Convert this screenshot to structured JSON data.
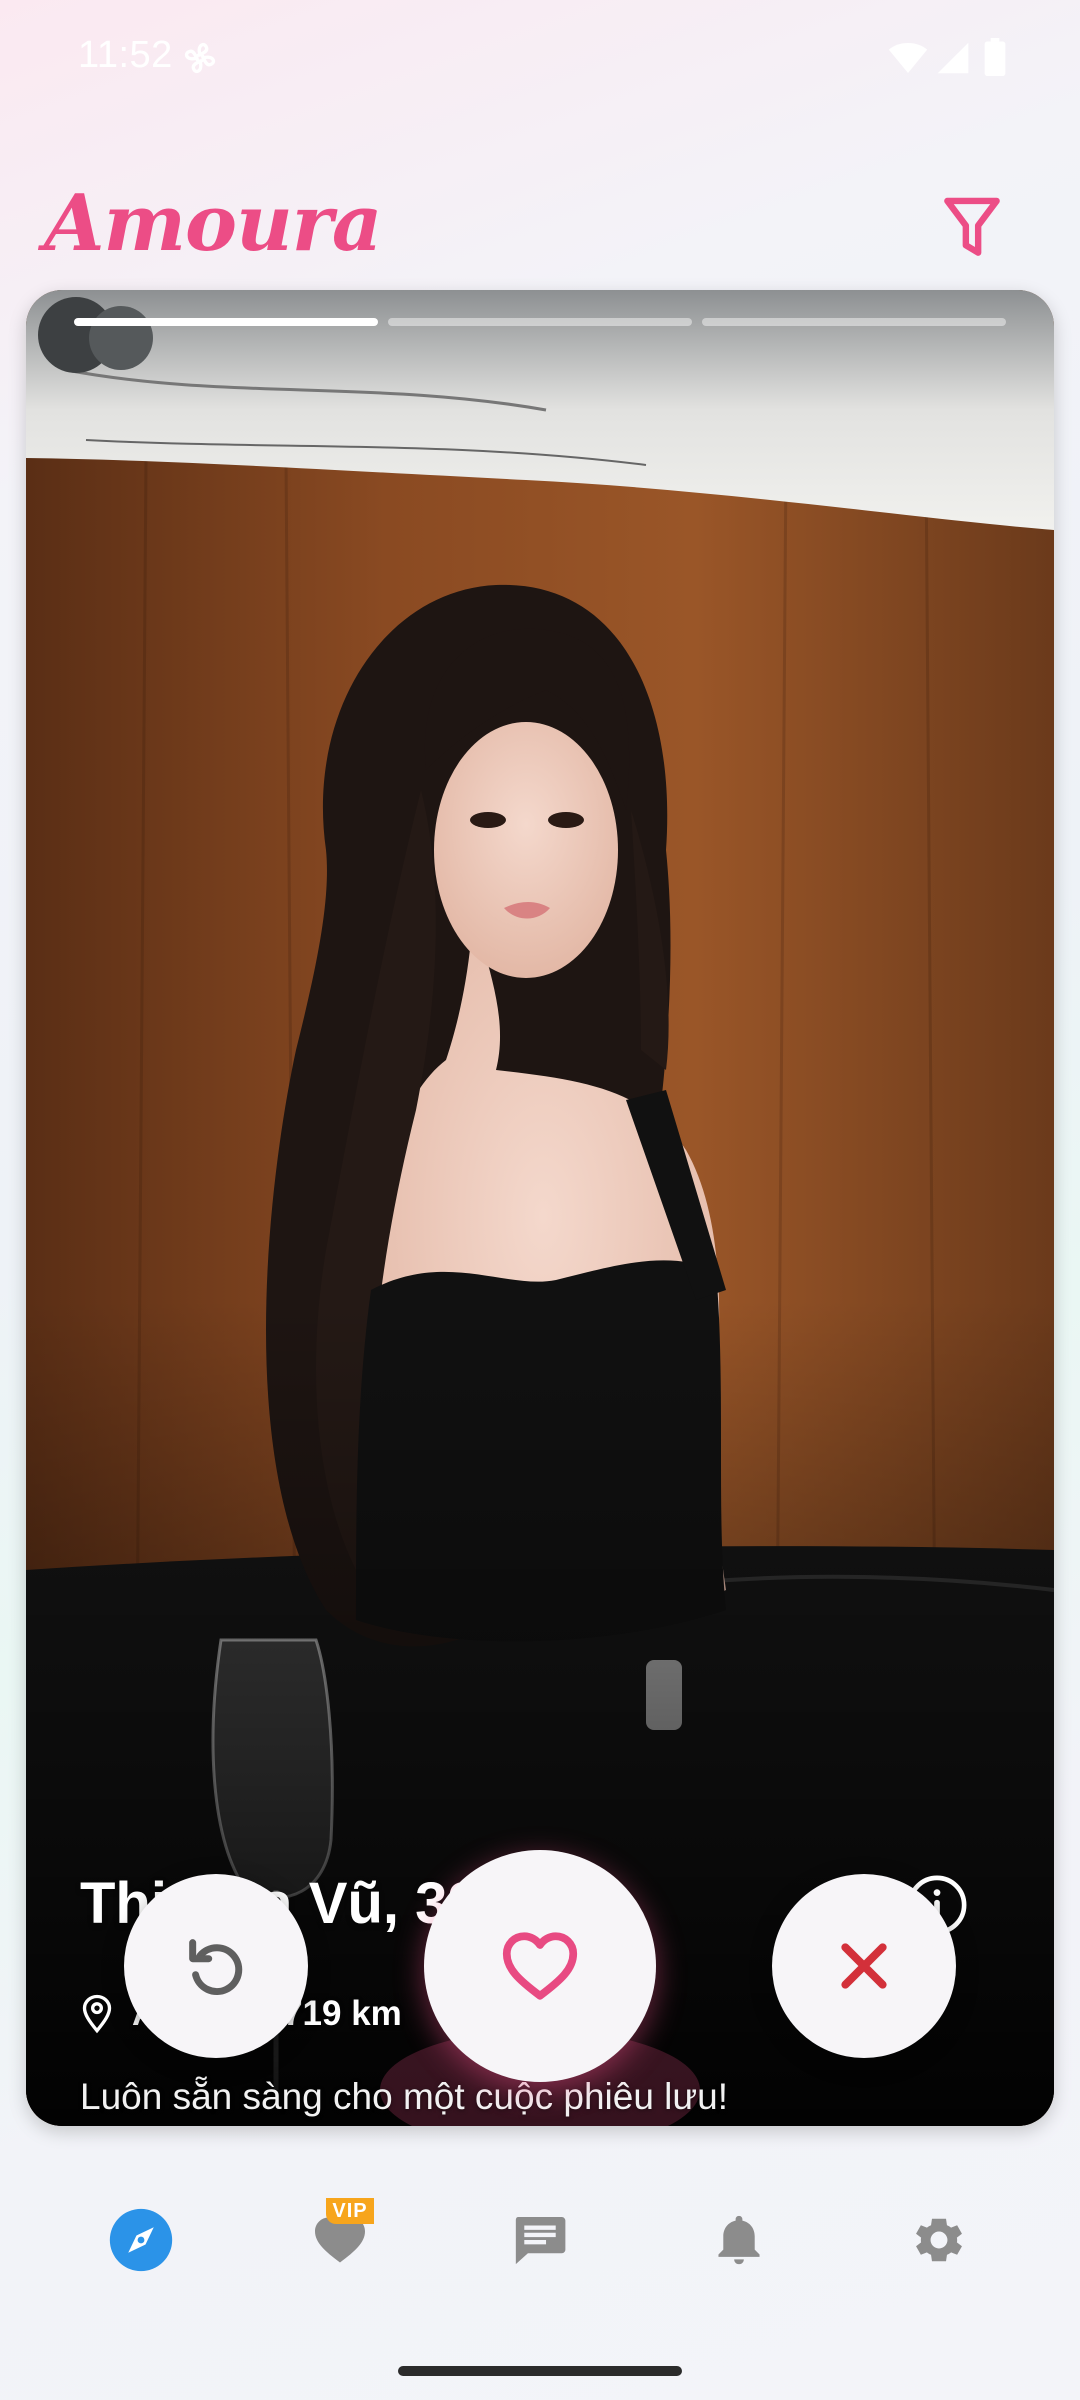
{
  "status_bar": {
    "time": "11:52"
  },
  "header": {
    "logo_text": "Amoura",
    "filter_icon": "filter-icon"
  },
  "card": {
    "photo_progress": {
      "total": 3,
      "current": 1
    },
    "name_age": "Thị Hoa Vũ, 32",
    "distance": "Away by 719 km",
    "bio": "Luôn sẵn sàng cho một cuộc phiêu lưu!"
  },
  "actions": {
    "rewind_icon": "rewind-icon",
    "like_icon": "heart-icon",
    "pass_icon": "close-icon"
  },
  "bottom_nav": {
    "items": [
      {
        "icon": "compass-icon",
        "active": true
      },
      {
        "icon": "heart-icon",
        "badge": "VIP"
      },
      {
        "icon": "chat-icon"
      },
      {
        "icon": "bell-icon"
      },
      {
        "icon": "gear-icon"
      }
    ]
  },
  "colors": {
    "brand": "#ec4d86",
    "nav_active": "#2b93e8",
    "nav_inactive": "#8c8c8c",
    "pass": "#d3303a",
    "vip": "#f7a51c"
  }
}
